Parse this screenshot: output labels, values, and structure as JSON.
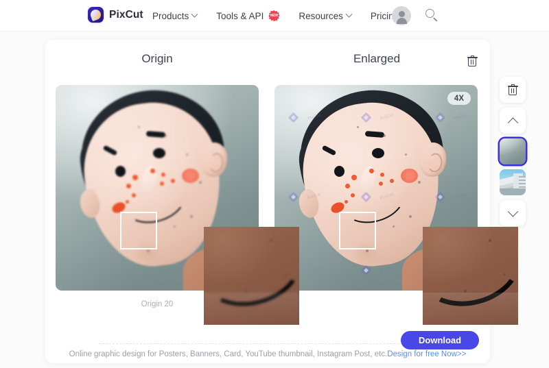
{
  "header": {
    "brand": {
      "name": "PixCut",
      "logo_icon": "pixcut-logo-icon"
    },
    "nav": [
      {
        "label": "Products",
        "has_caret": true,
        "badge": ""
      },
      {
        "label": "Tools & API",
        "has_caret": false,
        "badge": "NEW"
      },
      {
        "label": "Resources",
        "has_caret": true,
        "badge": ""
      },
      {
        "label": "Pricing",
        "has_caret": false,
        "badge": ""
      }
    ],
    "avatar_icon": "user-avatar-icon",
    "search_icon": "search-icon"
  },
  "editor": {
    "origin_title": "Origin",
    "enlarged_title": "Enlarged",
    "delete_icon": "trash-icon",
    "scale_badge": "4X",
    "origin_meta": "Origin 20",
    "download_label": "Download",
    "enlarged_meta": "",
    "watermark_text": "PixCut"
  },
  "footer": {
    "text": "Online graphic design for Posters, Banners, Card, YouTube thumbnail, Instagram Post, etc.",
    "link": "Design for free Now>>"
  },
  "toolbar": {
    "delete_icon": "trash-icon",
    "scroll_up_icon": "chevron-up-icon",
    "scroll_down_icon": "chevron-down-icon",
    "thumbnails": [
      {
        "name": "doll-face-thumbnail",
        "selected": true
      },
      {
        "name": "building-thumbnail",
        "selected": false
      }
    ]
  },
  "colors": {
    "accent": "#4a47e8",
    "link": "#5b8cf0",
    "badge_new": "#f5414f",
    "thumb_selected_border": "#3b2fe0"
  }
}
